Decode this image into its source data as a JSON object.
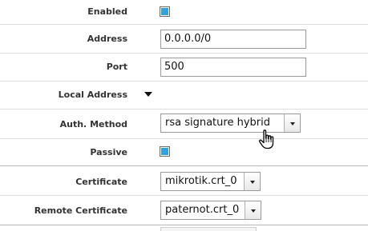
{
  "form": {
    "enabled": {
      "label": "Enabled",
      "checked": true
    },
    "address": {
      "label": "Address",
      "value": "0.0.0.0/0"
    },
    "port": {
      "label": "Port",
      "value": "500"
    },
    "local_address": {
      "label": "Local Address"
    },
    "auth_method": {
      "label": "Auth. Method",
      "selected": "rsa signature hybrid"
    },
    "passive": {
      "label": "Passive",
      "checked": true
    },
    "certificate": {
      "label": "Certificate",
      "selected": "mikrotik.crt_0"
    },
    "remote_certificate": {
      "label": "Remote Certificate",
      "selected": "paternot.crt_0"
    }
  },
  "icons": {
    "expander": "triangle-down-icon",
    "dropdown": "chevron-down-icon",
    "cursor": "hand-pointer-icon"
  },
  "colors": {
    "checkbox_fill": "#2fa2e3",
    "label_text": "#333333",
    "separator": "#dddddd"
  }
}
